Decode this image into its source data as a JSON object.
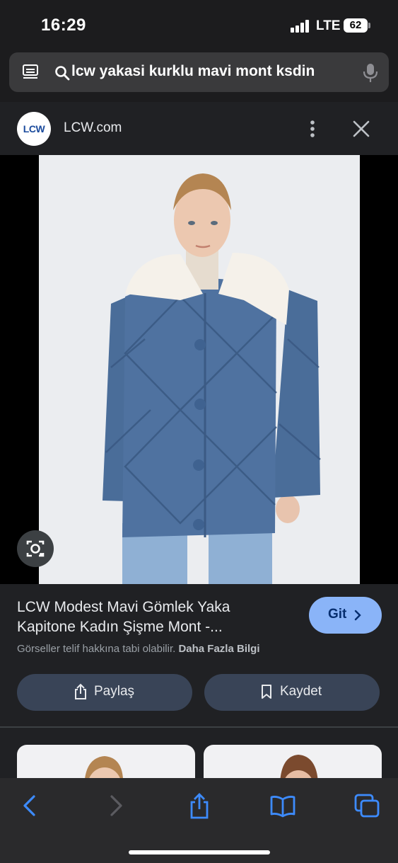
{
  "status_bar": {
    "time": "16:29",
    "network": "LTE",
    "battery": "62"
  },
  "search": {
    "query": "lcw yakasi kurklu mavi mont ksdin"
  },
  "source": {
    "logo_text": "LCW",
    "name": "LCW.com"
  },
  "product": {
    "title_line1": "LCW Modest Mavi Gömlek Yaka",
    "title_line2": "Kapitone Kadın Şişme Mont -...",
    "copyright_text": "Görseller telif hakkına tabi olabilir.",
    "more_info": "Daha Fazla Bilgi",
    "visit_label": "Git",
    "share_label": "Paylaş",
    "save_label": "Kaydet"
  },
  "icons": {
    "tabs": "tabs-icon",
    "search": "search-icon",
    "mic": "mic-icon",
    "more": "more-vertical-icon",
    "close": "close-icon",
    "lens": "lens-icon",
    "share": "share-icon",
    "bookmark": "bookmark-icon",
    "back": "back-icon",
    "forward": "forward-icon",
    "book": "bookmarks-book-icon",
    "tabs_overview": "tabs-overview-icon"
  },
  "colors": {
    "accent": "#8ab4f8",
    "accent_dark_text": "#062e6f",
    "pill": "#394457",
    "safari_blue": "#3d8bfd",
    "jacket": "#4a6d99"
  }
}
